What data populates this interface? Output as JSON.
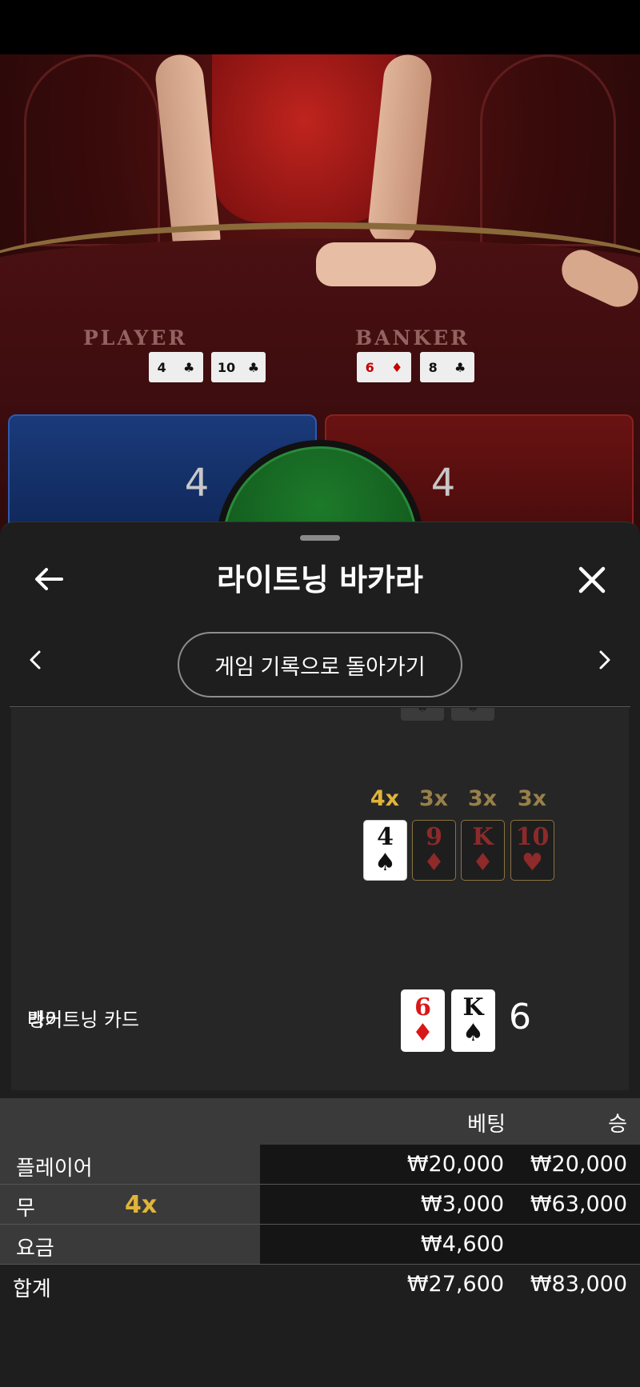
{
  "video": {
    "player_label": "PLAYER",
    "banker_label": "BANKER",
    "player_cards": [
      {
        "rank": "4",
        "suit": "♣"
      },
      {
        "rank": "10",
        "suit": "♣"
      }
    ],
    "banker_cards": [
      {
        "rank": "6",
        "suit": "♦"
      },
      {
        "rank": "8",
        "suit": "♣"
      }
    ],
    "player_score": "4",
    "banker_score": "4"
  },
  "sheet": {
    "title": "라이트닝 바카라",
    "back_to_history": "게임 기록으로 돌아가기",
    "lightning_label": "라이트닝 카드",
    "lightning_multipliers": [
      "4x",
      "3x",
      "3x",
      "3x"
    ],
    "lightning_cards": [
      {
        "rank": "4",
        "suit": "♠"
      },
      {
        "rank": "9",
        "suit": "♦"
      },
      {
        "rank": "K",
        "suit": "♦"
      },
      {
        "rank": "10",
        "suit": "♥"
      }
    ],
    "banker_label": "뱅커",
    "banker_cards": [
      {
        "rank": "6",
        "suit": "♦"
      },
      {
        "rank": "K",
        "suit": "♠"
      }
    ],
    "banker_total": "6"
  },
  "bets": {
    "header": {
      "bet": "베팅",
      "win": "승"
    },
    "rows": [
      {
        "label": "플레이어",
        "multiplier": "",
        "bet": "₩20,000",
        "win": "₩20,000"
      },
      {
        "label": "무",
        "multiplier": "4x",
        "bet": "₩3,000",
        "win": "₩63,000"
      },
      {
        "label": "요금",
        "multiplier": "",
        "bet": "₩4,600",
        "win": ""
      }
    ],
    "total": {
      "label": "합계",
      "bet": "₩27,600",
      "win": "₩83,000"
    }
  },
  "icons": {
    "back": "arrow-left-icon",
    "close": "close-icon",
    "prev": "chevron-left-icon",
    "next": "chevron-right-icon"
  },
  "colors": {
    "gold": "#e0b43a",
    "player_blue": "#1a3a7a",
    "banker_red": "#6a1212",
    "tie_green": "#1d7a2a"
  }
}
